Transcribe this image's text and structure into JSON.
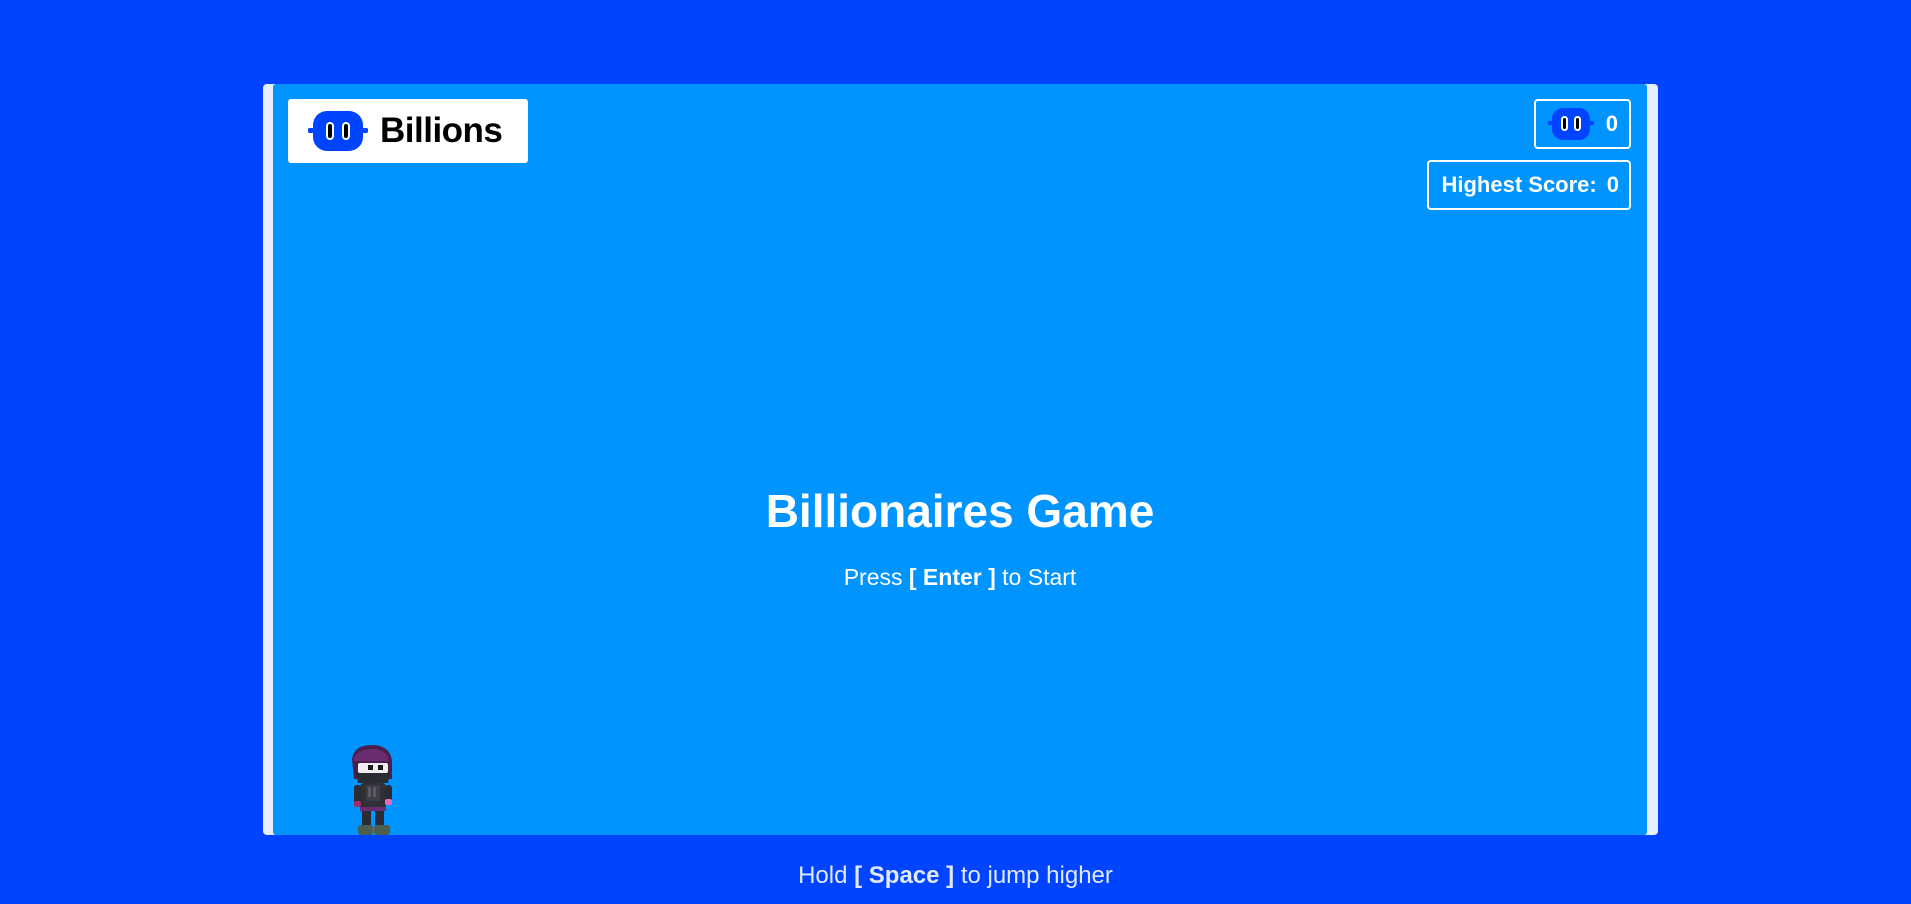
{
  "brand": {
    "name": "Billions",
    "icon": "billions-robot-icon",
    "accent": "#0044ff"
  },
  "hud": {
    "coins": "0",
    "coin_icon": "billions-robot-icon",
    "highest_score_label": "Highest Score:",
    "highest_score": "0"
  },
  "start_screen": {
    "title": "Billionaires Game",
    "prompt_before": "Press",
    "prompt_key": "[ Enter ]",
    "prompt_after": "to Start"
  },
  "player": {
    "icon": "ninja-character"
  },
  "hint": {
    "before": "Hold",
    "key": "[ Space ]",
    "after": "to jump higher"
  },
  "colors": {
    "page_background": "#0044ff",
    "game_background": "#0094ff",
    "text": "#ffffff"
  }
}
